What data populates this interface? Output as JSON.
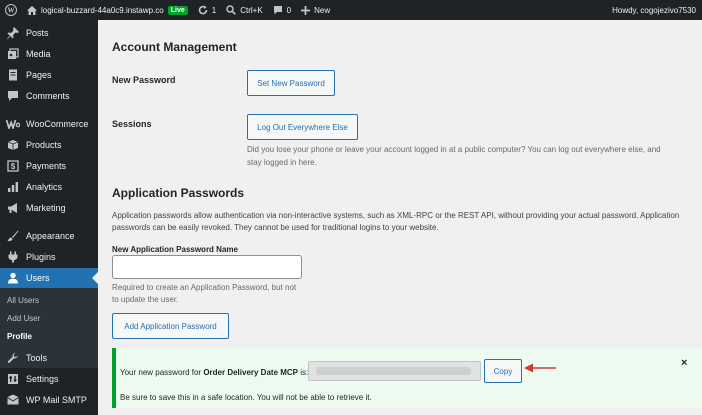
{
  "admin_bar": {
    "site_name": "logical-buzzard-44a0c9.instawp.co",
    "live_badge": "Live",
    "updates_count": "1",
    "command_shortcut": "Ctrl+K",
    "comments_count": "0",
    "new_label": "New",
    "howdy": "Howdy, cogojezivo7530"
  },
  "sidebar": {
    "items": [
      {
        "label": "Posts",
        "icon": "pushpin-icon"
      },
      {
        "label": "Media",
        "icon": "media-icon"
      },
      {
        "label": "Pages",
        "icon": "pages-icon"
      },
      {
        "label": "Comments",
        "icon": "comment-icon"
      },
      {
        "label": "WooCommerce",
        "icon": "woocommerce-icon"
      },
      {
        "label": "Products",
        "icon": "products-icon"
      },
      {
        "label": "Payments",
        "icon": "payments-icon"
      },
      {
        "label": "Analytics",
        "icon": "analytics-icon"
      },
      {
        "label": "Marketing",
        "icon": "megaphone-icon"
      },
      {
        "label": "Appearance",
        "icon": "paintbrush-icon"
      },
      {
        "label": "Plugins",
        "icon": "plugin-icon"
      },
      {
        "label": "Users",
        "icon": "users-icon"
      },
      {
        "label": "Tools",
        "icon": "wrench-icon"
      },
      {
        "label": "Settings",
        "icon": "settings-icon"
      },
      {
        "label": "WP Mail SMTP",
        "icon": "mail-icon"
      }
    ],
    "submenu": [
      "All Users",
      "Add User",
      "Profile"
    ]
  },
  "account": {
    "heading": "Account Management",
    "new_password_label": "New Password",
    "set_new_password_button": "Set New Password",
    "sessions_label": "Sessions",
    "logout_everywhere_button": "Log Out Everywhere Else",
    "sessions_desc_line1": "Did you lose your phone or leave your account logged in at a public computer? You can log out everywhere else, and",
    "sessions_desc_line2": "stay logged in here."
  },
  "app_passwords": {
    "heading": "Application Passwords",
    "intro_line1": "Application passwords allow authentication via non-interactive systems, such as XML-RPC or the REST API, without providing your actual password. Application",
    "intro_line2": "passwords can be easily revoked. They cannot be used for traditional logins to your website.",
    "name_label": "New Application Password Name",
    "name_value": "",
    "hint_line1": "Required to create an Application Password, but not",
    "hint_line2": "to update the user.",
    "add_button": "Add Application Password"
  },
  "notice": {
    "text_prefix": "Your new password for ",
    "app_name": "Order Delivery Date MCP",
    "text_suffix": " is:",
    "copy_button": "Copy",
    "save_note": "Be sure to save this in a safe location. You will not be able to retrieve it.",
    "dismiss": "×"
  },
  "colors": {
    "admin_dark": "#1d2327",
    "accent_blue": "#2271b1",
    "success_green": "#00a32a",
    "arrow_red": "#d63638"
  }
}
